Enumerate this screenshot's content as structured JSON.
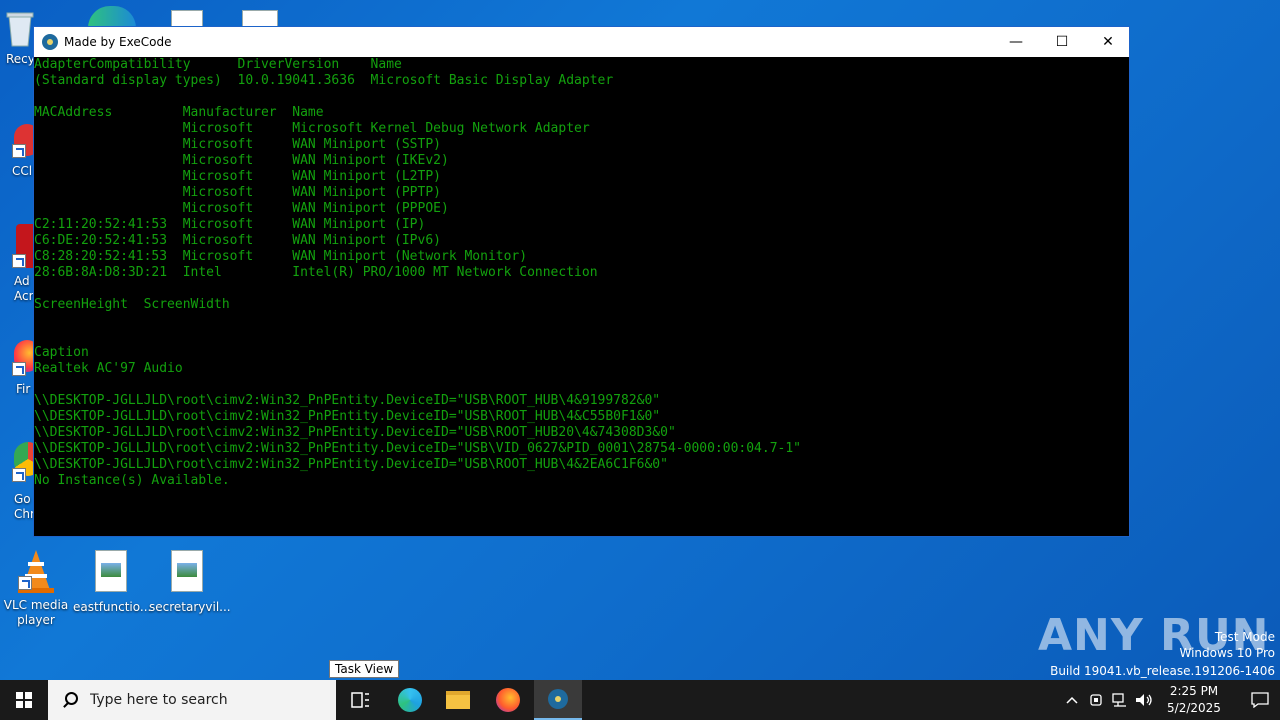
{
  "desktop": {
    "icons": [
      {
        "label": "Recy",
        "x": 4
      },
      {
        "label": "CCl"
      },
      {
        "label": "Ad Acr"
      },
      {
        "label": "Fir"
      },
      {
        "label": "Go Chr"
      },
      {
        "label": "VLC media player"
      },
      {
        "label": "eastfunctio..."
      },
      {
        "label": "secretaryvil..."
      }
    ]
  },
  "window": {
    "title": "Made by ExeCode",
    "minimize": "—",
    "maximize": "☐",
    "close": "✕",
    "lines": [
      "AdapterCompatibility      DriverVersion    Name",
      "(Standard display types)  10.0.19041.3636  Microsoft Basic Display Adapter",
      "",
      "MACAddress         Manufacturer  Name",
      "                   Microsoft     Microsoft Kernel Debug Network Adapter",
      "                   Microsoft     WAN Miniport (SSTP)",
      "                   Microsoft     WAN Miniport (IKEv2)",
      "                   Microsoft     WAN Miniport (L2TP)",
      "                   Microsoft     WAN Miniport (PPTP)",
      "                   Microsoft     WAN Miniport (PPPOE)",
      "C2:11:20:52:41:53  Microsoft     WAN Miniport (IP)",
      "C6:DE:20:52:41:53  Microsoft     WAN Miniport (IPv6)",
      "C8:28:20:52:41:53  Microsoft     WAN Miniport (Network Monitor)",
      "28:6B:8A:D8:3D:21  Intel         Intel(R) PRO/1000 MT Network Connection",
      "",
      "ScreenHeight  ScreenWidth",
      "",
      "",
      "Caption",
      "Realtek AC'97 Audio",
      "",
      "\\\\DESKTOP-JGLLJLD\\root\\cimv2:Win32_PnPEntity.DeviceID=\"USB\\ROOT_HUB\\4&9199782&0\"",
      "\\\\DESKTOP-JGLLJLD\\root\\cimv2:Win32_PnPEntity.DeviceID=\"USB\\ROOT_HUB\\4&C55B0F1&0\"",
      "\\\\DESKTOP-JGLLJLD\\root\\cimv2:Win32_PnPEntity.DeviceID=\"USB\\ROOT_HUB20\\4&74308D3&0\"",
      "\\\\DESKTOP-JGLLJLD\\root\\cimv2:Win32_PnPEntity.DeviceID=\"USB\\VID_0627&PID_0001\\28754-0000:00:04.7-1\"",
      "\\\\DESKTOP-JGLLJLD\\root\\cimv2:Win32_PnPEntity.DeviceID=\"USB\\ROOT_HUB\\4&2EA6C1F6&0\"",
      "No Instance(s) Available."
    ]
  },
  "tooltip": "Task View",
  "watermark": {
    "logo": "ANY RUN",
    "line1": "Test Mode",
    "line2": "Windows 10 Pro",
    "line3": "Build 19041.vb_release.191206-1406"
  },
  "taskbar": {
    "search_placeholder": "Type here to search",
    "time": "2:25 PM",
    "date": "5/2/2025"
  },
  "colors": {
    "terminal_text": "#13a10e",
    "taskbar": "#1a1a1a"
  }
}
